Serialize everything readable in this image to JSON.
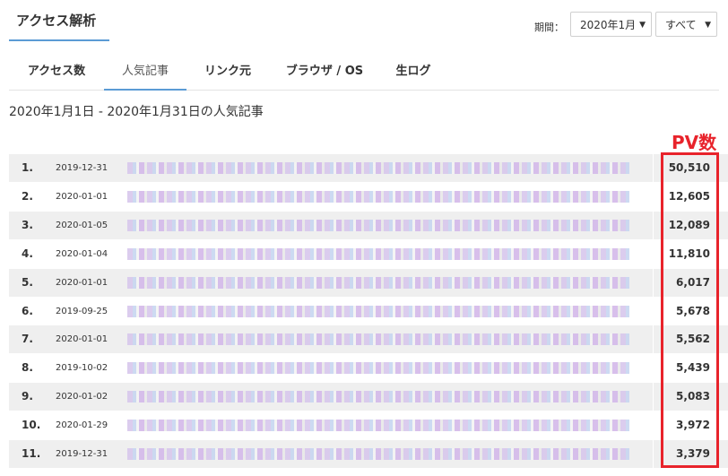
{
  "header": {
    "title": "アクセス解析",
    "period_label": "期間：",
    "month_select": "2020年1月",
    "scope_select": "すべて"
  },
  "tabs": [
    {
      "label": "アクセス数",
      "active": false
    },
    {
      "label": "人気記事",
      "active": true
    },
    {
      "label": "リンク元",
      "active": false
    },
    {
      "label": "ブラウザ / OS",
      "active": false
    },
    {
      "label": "生ログ",
      "active": false
    }
  ],
  "range_title": "2020年1月1日 - 2020年1月31日の人気記事",
  "pv_annotation": "PV数",
  "rows": [
    {
      "rank": "1.",
      "date": "2019-12-31",
      "pv": "50,510"
    },
    {
      "rank": "2.",
      "date": "2020-01-01",
      "pv": "12,605"
    },
    {
      "rank": "3.",
      "date": "2020-01-05",
      "pv": "12,089"
    },
    {
      "rank": "4.",
      "date": "2020-01-04",
      "pv": "11,810"
    },
    {
      "rank": "5.",
      "date": "2020-01-01",
      "pv": "6,017"
    },
    {
      "rank": "6.",
      "date": "2019-09-25",
      "pv": "5,678"
    },
    {
      "rank": "7.",
      "date": "2020-01-01",
      "pv": "5,562"
    },
    {
      "rank": "8.",
      "date": "2019-10-02",
      "pv": "5,439"
    },
    {
      "rank": "9.",
      "date": "2020-01-02",
      "pv": "5,083"
    },
    {
      "rank": "10.",
      "date": "2020-01-29",
      "pv": "3,972"
    },
    {
      "rank": "11.",
      "date": "2019-12-31",
      "pv": "3,379"
    }
  ],
  "colors": {
    "accent": "#5b9bd5",
    "highlight": "#e8232b",
    "row_stripe": "#efefef"
  }
}
